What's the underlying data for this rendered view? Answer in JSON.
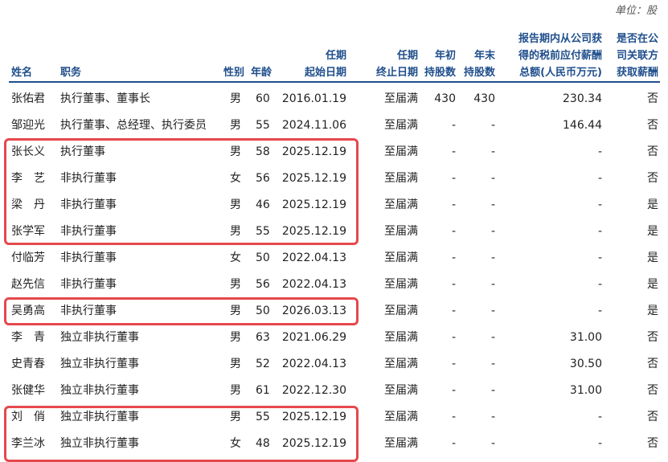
{
  "unit_label": "单位：股",
  "headers": {
    "name": "姓名",
    "position": "职务",
    "gender": "性别",
    "age": "年龄",
    "term_start": [
      "任期",
      "起始日期"
    ],
    "term_end": [
      "任期",
      "终止日期"
    ],
    "shares_begin": [
      "年初",
      "持股数"
    ],
    "shares_end": [
      "年末",
      "持股数"
    ],
    "compensation": [
      "报告期内从公司获",
      "得的税前应付薪酬",
      "总额(人民币万元)"
    ],
    "related_pay": [
      "是否在公",
      "司关联方",
      "获取薪酬"
    ]
  },
  "rows": [
    {
      "name": "张佑君",
      "position": "执行董事、董事长",
      "gender": "男",
      "age": "60",
      "start": "2016.01.19",
      "end": "至届满",
      "shares_begin": "430",
      "shares_end": "430",
      "pay": "230.34",
      "related": "否"
    },
    {
      "name": "邹迎光",
      "position": "执行董事、总经理、执行委员",
      "gender": "男",
      "age": "55",
      "start": "2024.11.06",
      "end": "至届满",
      "shares_begin": "-",
      "shares_end": "-",
      "pay": "146.44",
      "related": "否"
    },
    {
      "name": "张长义",
      "position": "执行董事",
      "gender": "男",
      "age": "58",
      "start": "2025.12.19",
      "end": "至届满",
      "shares_begin": "-",
      "shares_end": "-",
      "pay": "-",
      "related": "否"
    },
    {
      "name": "李　艺",
      "position": "非执行董事",
      "gender": "女",
      "age": "56",
      "start": "2025.12.19",
      "end": "至届满",
      "shares_begin": "-",
      "shares_end": "-",
      "pay": "-",
      "related": "否"
    },
    {
      "name": "梁　丹",
      "position": "非执行董事",
      "gender": "男",
      "age": "46",
      "start": "2025.12.19",
      "end": "至届满",
      "shares_begin": "-",
      "shares_end": "-",
      "pay": "-",
      "related": "是"
    },
    {
      "name": "张学军",
      "position": "非执行董事",
      "gender": "男",
      "age": "55",
      "start": "2025.12.19",
      "end": "至届满",
      "shares_begin": "-",
      "shares_end": "-",
      "pay": "-",
      "related": "是"
    },
    {
      "name": "付临芳",
      "position": "非执行董事",
      "gender": "女",
      "age": "50",
      "start": "2022.04.13",
      "end": "至届满",
      "shares_begin": "-",
      "shares_end": "-",
      "pay": "-",
      "related": "是"
    },
    {
      "name": "赵先信",
      "position": "非执行董事",
      "gender": "男",
      "age": "56",
      "start": "2022.04.13",
      "end": "至届满",
      "shares_begin": "-",
      "shares_end": "-",
      "pay": "-",
      "related": "是"
    },
    {
      "name": "吴勇高",
      "position": "非执行董事",
      "gender": "男",
      "age": "50",
      "start": "2026.03.13",
      "end": "至届满",
      "shares_begin": "-",
      "shares_end": "-",
      "pay": "-",
      "related": "是"
    },
    {
      "name": "李　青",
      "position": "独立非执行董事",
      "gender": "男",
      "age": "63",
      "start": "2021.06.29",
      "end": "至届满",
      "shares_begin": "-",
      "shares_end": "-",
      "pay": "31.00",
      "related": "否"
    },
    {
      "name": "史青春",
      "position": "独立非执行董事",
      "gender": "男",
      "age": "52",
      "start": "2022.04.13",
      "end": "至届满",
      "shares_begin": "-",
      "shares_end": "-",
      "pay": "30.50",
      "related": "否"
    },
    {
      "name": "张健华",
      "position": "独立非执行董事",
      "gender": "男",
      "age": "61",
      "start": "2022.12.30",
      "end": "至届满",
      "shares_begin": "-",
      "shares_end": "-",
      "pay": "31.00",
      "related": "否"
    },
    {
      "name": "刘　俏",
      "position": "独立非执行董事",
      "gender": "男",
      "age": "55",
      "start": "2025.12.19",
      "end": "至届满",
      "shares_begin": "-",
      "shares_end": "-",
      "pay": "-",
      "related": "否"
    },
    {
      "name": "李兰冰",
      "position": "独立非执行董事",
      "gender": "女",
      "age": "48",
      "start": "2025.12.19",
      "end": "至届满",
      "shares_begin": "-",
      "shares_end": "-",
      "pay": "-",
      "related": "否"
    }
  ],
  "colors": {
    "header": "#1f4e8c",
    "highlight": "#e5484d"
  }
}
